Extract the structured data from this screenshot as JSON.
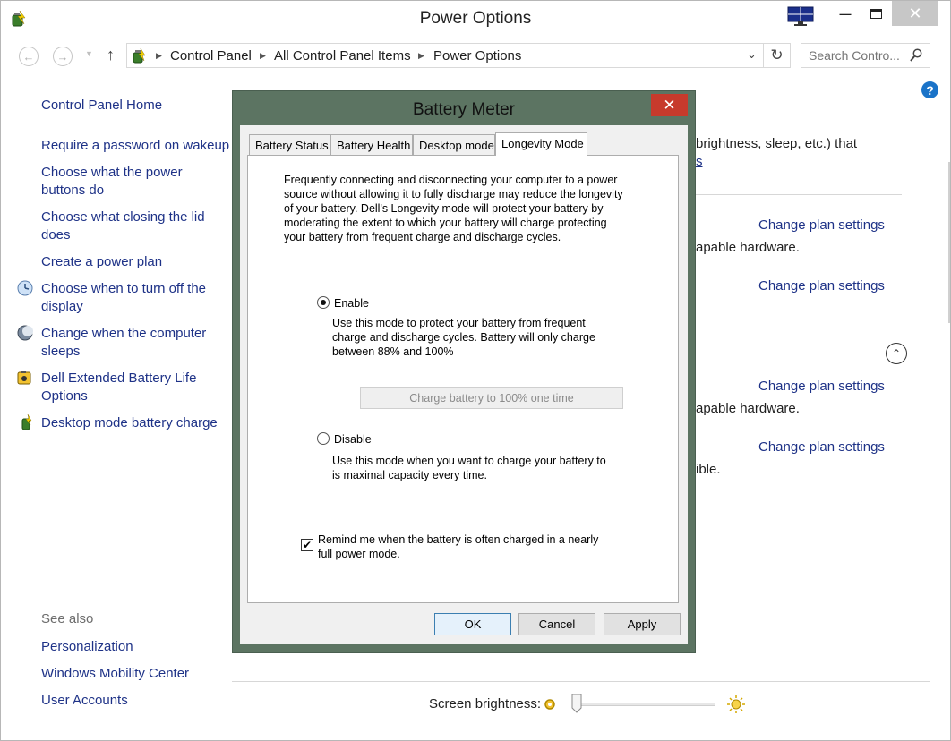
{
  "window": {
    "title": "Power Options",
    "close_glyph": "✕",
    "min_glyph": "—",
    "max_glyph": "☐"
  },
  "address_bar": {
    "crumbs": [
      "Control Panel",
      "All Control Panel Items",
      "Power Options"
    ],
    "search_placeholder": "Search Contro..."
  },
  "left_nav": {
    "items": [
      {
        "label": "Control Panel Home"
      },
      {
        "label": "Require a password on wakeup"
      },
      {
        "label": "Choose what the power buttons do"
      },
      {
        "label": "Choose what closing the lid does"
      },
      {
        "label": "Create a power plan"
      },
      {
        "label": "Choose when to turn off the display"
      },
      {
        "label": "Change when the computer sleeps"
      },
      {
        "label": "Dell Extended Battery Life Options"
      },
      {
        "label": "Desktop mode battery charge"
      }
    ],
    "see_also_title": "See also",
    "see_also": [
      "Personalization",
      "Windows Mobility Center",
      "User Accounts"
    ]
  },
  "background_content": {
    "line1": "brightness, sleep, etc.) that",
    "line1_link": "s",
    "change_plan_settings": "Change plan settings",
    "capable_hardware": "apable hardware.",
    "ible": "ible."
  },
  "brightness": {
    "label": "Screen brightness:",
    "level_percent": 0
  },
  "dialog": {
    "title": "Battery Meter",
    "tabs": [
      "Battery Status",
      "Battery Health",
      "Desktop mode",
      "Longevity Mode"
    ],
    "active_tab": "Longevity Mode",
    "description": "Frequently connecting and disconnecting your computer to a power source without allowing it to fully discharge may reduce the longevity of your battery. Dell's Longevity mode will protect your battery by moderating the extent to which your battery will charge protecting your battery from frequent charge and discharge cycles.",
    "description_lines": [
      "Frequently connecting and disconnecting your computer to a power",
      "source without allowing it to fully discharge may reduce the longevity",
      "of your battery. Dell's Longevity mode will protect your battery by",
      "moderating the extent to which your battery will charge protecting",
      "your battery from frequent charge and discharge cycles."
    ],
    "enable_label": "Enable",
    "enable_selected": true,
    "enable_desc_lines": [
      "Use this mode to protect your battery from frequent",
      "charge and discharge cycles. Battery will only charge",
      "between 88% and 100%"
    ],
    "charge_button": "Charge battery to 100% one time",
    "disable_label": "Disable",
    "disable_desc_lines": [
      "Use this mode when you want to charge your battery to",
      "is maximal capacity every time."
    ],
    "remind_lines": [
      "Remind me when the battery is often charged in a nearly",
      "full power mode."
    ],
    "remind_checked": true,
    "ok_label": "OK",
    "cancel_label": "Cancel",
    "apply_label": "Apply"
  }
}
